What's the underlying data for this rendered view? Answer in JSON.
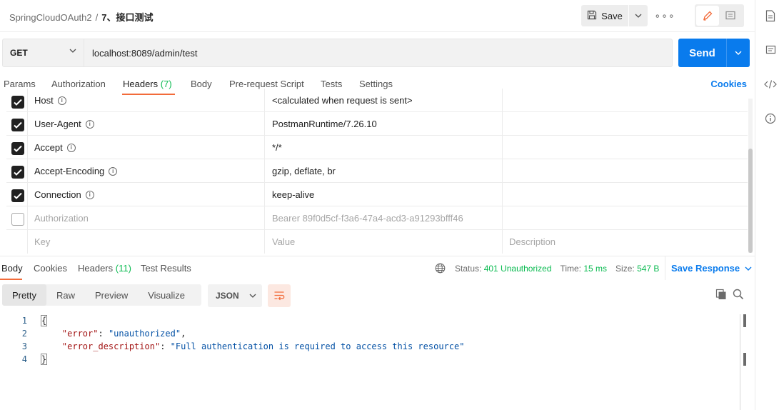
{
  "breadcrumb": {
    "collection": "SpringCloudOAuth2",
    "separator": "/",
    "request": "7、接口测试"
  },
  "toolbar": {
    "save_label": "Save",
    "more_label": "∘∘∘"
  },
  "request": {
    "method": "GET",
    "url": "localhost:8089/admin/test",
    "send_label": "Send"
  },
  "request_tabs": [
    {
      "label": "Params"
    },
    {
      "label": "Authorization"
    },
    {
      "label": "Headers",
      "count": "(7)"
    },
    {
      "label": "Body"
    },
    {
      "label": "Pre-request Script"
    },
    {
      "label": "Tests"
    },
    {
      "label": "Settings"
    }
  ],
  "cookies_link": "Cookies",
  "headers": [
    {
      "checked": true,
      "key": "Host",
      "value": "<calculated when request is sent>",
      "description": ""
    },
    {
      "checked": true,
      "key": "User-Agent",
      "value": "PostmanRuntime/7.26.10",
      "description": ""
    },
    {
      "checked": true,
      "key": "Accept",
      "value": "*/*",
      "description": ""
    },
    {
      "checked": true,
      "key": "Accept-Encoding",
      "value": "gzip, deflate, br",
      "description": ""
    },
    {
      "checked": true,
      "key": "Connection",
      "value": "keep-alive",
      "description": ""
    },
    {
      "checked": false,
      "key": "Authorization",
      "value": "Bearer 89f0d5cf-f3a6-47a4-acd3-a91293bfff46",
      "description": ""
    }
  ],
  "headers_placeholder": {
    "key": "Key",
    "value": "Value",
    "description": "Description"
  },
  "response_tabs": [
    {
      "label": "Body"
    },
    {
      "label": "Cookies"
    },
    {
      "label": "Headers",
      "count": "(11)"
    },
    {
      "label": "Test Results"
    }
  ],
  "response_status": {
    "status_label": "Status:",
    "status_value": "401 Unauthorized",
    "time_label": "Time:",
    "time_value": "15 ms",
    "size_label": "Size:",
    "size_value": "547 B",
    "save_response": "Save Response"
  },
  "format_tabs": [
    "Pretty",
    "Raw",
    "Preview",
    "Visualize"
  ],
  "language": "JSON",
  "code_lines": [
    {
      "n": "1",
      "text": "{"
    },
    {
      "n": "2",
      "key": "\"error\"",
      "value": "\"unauthorized\""
    },
    {
      "n": "3",
      "key": "\"error_description\"",
      "value": "\"Full authentication is required to access this resource\""
    },
    {
      "n": "4",
      "text": "}"
    }
  ],
  "colors": {
    "accent": "#097bed",
    "tab_underline": "#f26b3a",
    "success": "#0cbb52"
  }
}
